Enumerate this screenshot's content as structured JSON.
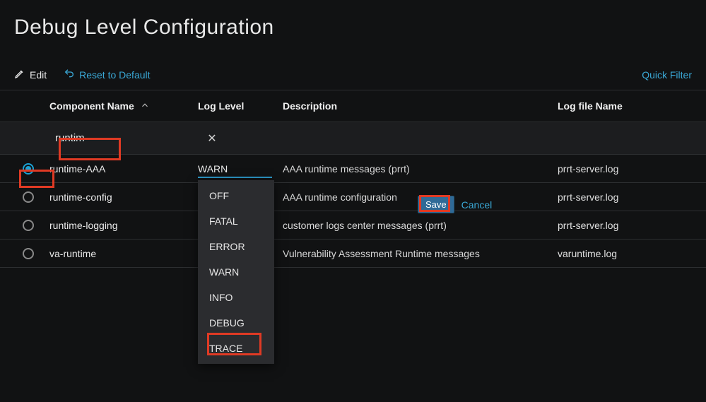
{
  "page": {
    "title": "Debug Level Configuration"
  },
  "toolbar": {
    "edit_label": "Edit",
    "reset_label": "Reset to Default",
    "quick_filter_label": "Quick Filter"
  },
  "columns": {
    "component_name": "Component Name",
    "log_level": "Log Level",
    "description": "Description",
    "log_file_name": "Log file Name"
  },
  "filter": {
    "component_name_value": "runtim"
  },
  "rows": [
    {
      "selected": true,
      "component": "runtime-AAA",
      "log_level": "WARN",
      "description": "AAA runtime messages (prrt)",
      "log_file": "prrt-server.log"
    },
    {
      "selected": false,
      "component": "runtime-config",
      "log_level": "",
      "description": "AAA runtime configuration",
      "log_file": "prrt-server.log"
    },
    {
      "selected": false,
      "component": "runtime-logging",
      "log_level": "",
      "description": "customer logs center messages (prrt)",
      "log_file": "prrt-server.log"
    },
    {
      "selected": false,
      "component": "va-runtime",
      "log_level": "",
      "description": "Vulnerability Assessment Runtime messages",
      "log_file": "varuntime.log"
    }
  ],
  "log_level_options": [
    "OFF",
    "FATAL",
    "ERROR",
    "WARN",
    "INFO",
    "DEBUG",
    "TRACE"
  ],
  "inline_actions": {
    "save_label": "Save",
    "cancel_label": "Cancel"
  },
  "highlight_color": "#e03a24",
  "accent_color": "#3aa8d6",
  "highlighted_option": "DEBUG"
}
